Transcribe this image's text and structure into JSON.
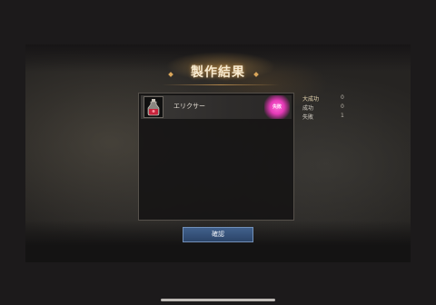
{
  "title": "製作結果",
  "results": [
    {
      "item_name": "エリクサー",
      "icon": "potion-bottle-icon",
      "badge": "失敗"
    }
  ],
  "stats": [
    {
      "label": "大成功",
      "value": "0"
    },
    {
      "label": "成功",
      "value": "0"
    },
    {
      "label": "失敗",
      "value": "1"
    }
  ],
  "confirm_label": "確認",
  "colors": {
    "badge": "#e63ab8",
    "button": "#2b4468",
    "title": "#f6e9cf"
  }
}
